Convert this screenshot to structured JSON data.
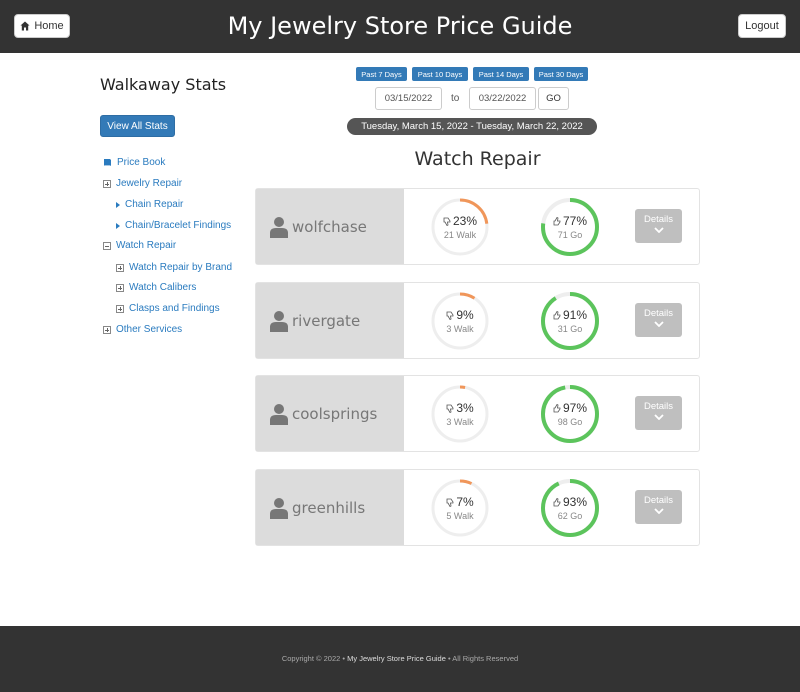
{
  "header": {
    "title": "My Jewelry Store Price Guide",
    "home_label": "Home",
    "logout_label": "Logout"
  },
  "sidebar": {
    "title": "Walkaway Stats",
    "view_all_label": "View All Stats",
    "items": [
      {
        "label": "Price Book",
        "icon": "book-icon"
      },
      {
        "label": "Jewelry Repair",
        "icon": "expand-plus-icon"
      },
      {
        "label": "Chain Repair",
        "icon": "caret-right-icon"
      },
      {
        "label": "Chain/Bracelet Findings",
        "icon": "caret-right-icon"
      },
      {
        "label": "Watch Repair",
        "icon": "collapse-minus-icon"
      },
      {
        "label": "Watch Repair by Brand",
        "icon": "expand-plus-icon"
      },
      {
        "label": "Watch Calibers",
        "icon": "expand-plus-icon"
      },
      {
        "label": "Clasps and Findings",
        "icon": "expand-plus-icon"
      },
      {
        "label": "Other Services",
        "icon": "expand-plus-icon"
      }
    ]
  },
  "range_buttons": [
    "Past 7 Days",
    "Past 10 Days",
    "Past 14 Days",
    "Past 30 Days"
  ],
  "date_range": {
    "from": "03/15/2022",
    "to_label": "to",
    "to": "03/22/2022",
    "go_label": "GO",
    "summary": "Tuesday, March 15, 2022 - Tuesday, March 22, 2022"
  },
  "section_title": "Watch Repair",
  "colors": {
    "walk": "#f0965a",
    "go": "#5cc45c",
    "track": "#eeeeee",
    "header_bg": "#333333",
    "primary": "#337ab7"
  },
  "stores": [
    {
      "name": "wolfchase",
      "walk_pct_label": "23%",
      "walk_pct": 0.23,
      "walk_count": "21 Walk",
      "go_pct_label": "77%",
      "go_pct": 0.77,
      "go_count": "71 Go",
      "details_label": "Details"
    },
    {
      "name": "rivergate",
      "walk_pct_label": "9%",
      "walk_pct": 0.09,
      "walk_count": "3 Walk",
      "go_pct_label": "91%",
      "go_pct": 0.91,
      "go_count": "31 Go",
      "details_label": "Details"
    },
    {
      "name": "coolsprings",
      "walk_pct_label": "3%",
      "walk_pct": 0.03,
      "walk_count": "3 Walk",
      "go_pct_label": "97%",
      "go_pct": 0.97,
      "go_count": "98 Go",
      "details_label": "Details"
    },
    {
      "name": "greenhills",
      "walk_pct_label": "7%",
      "walk_pct": 0.07,
      "walk_count": "5 Walk",
      "go_pct_label": "93%",
      "go_pct": 0.93,
      "go_count": "62 Go",
      "details_label": "Details"
    }
  ],
  "footer": {
    "prefix": "Copyright © 2022 •",
    "brand": "My Jewelry Store Price Guide",
    "suffix": "• All Rights Reserved"
  }
}
